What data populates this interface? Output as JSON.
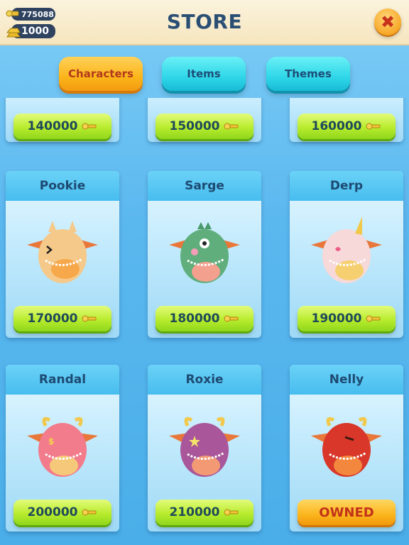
{
  "header": {
    "title": "STORE",
    "currency_top": "775088",
    "currency_bottom": "1000",
    "close_symbol": "✖"
  },
  "tabs": [
    {
      "label": "Characters",
      "active": true
    },
    {
      "label": "Items",
      "active": false
    },
    {
      "label": "Themes",
      "active": false
    }
  ],
  "top_row_prices": [
    "140000",
    "150000",
    "160000"
  ],
  "characters": [
    {
      "name": "Pookie",
      "price": "170000",
      "owned": false,
      "color": "#f5c98a",
      "belly": "#f7a84a"
    },
    {
      "name": "Sarge",
      "price": "180000",
      "owned": false,
      "color": "#5fae7c",
      "belly": "#f3a08f"
    },
    {
      "name": "Derp",
      "price": "190000",
      "owned": false,
      "color": "#f6d9d8",
      "belly": "#f6cf70"
    },
    {
      "name": "Randal",
      "price": "200000",
      "owned": false,
      "color": "#f27c8c",
      "belly": "#f6c97a"
    },
    {
      "name": "Roxie",
      "price": "210000",
      "owned": false,
      "color": "#a9569a",
      "belly": "#f39a74"
    },
    {
      "name": "Nelly",
      "price": "",
      "owned": true,
      "owned_label": "OWNED",
      "color": "#d8372a",
      "belly": "#f3873e"
    }
  ]
}
